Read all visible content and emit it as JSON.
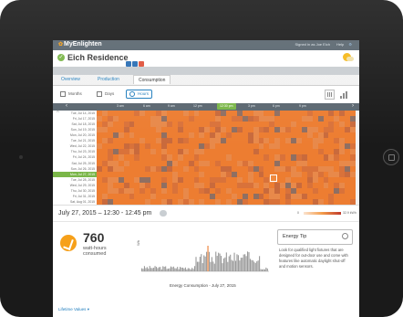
{
  "header": {
    "logo": "MyEnlighten",
    "signed_in": "Signed in as Joe Eich",
    "help": "Help"
  },
  "site": {
    "name": "Eich Residence"
  },
  "tabs": [
    {
      "label": "Overview"
    },
    {
      "label": "Production"
    },
    {
      "label": "Consumption"
    }
  ],
  "toolbar": {
    "months": "Months",
    "days": "Days",
    "hours": "Hours"
  },
  "hours": [
    "3 am",
    "6 am",
    "9 am",
    "12 pm",
    "12:30 pm",
    "3 pm",
    "6 pm",
    "9 pm"
  ],
  "dates": [
    "Tue, Jul 14, 2015",
    "Fri, Jul 17, 2015",
    "Sat, Jul 18, 2015",
    "Sun, Jul 19, 2015",
    "Mon, Jul 20, 2015",
    "Tue, Jul 21, 2015",
    "Wed, Jul 22, 2015",
    "Thu, Jul 23, 2015",
    "Fri, Jul 24, 2015",
    "Sat, Jul 25, 2015",
    "Sun, Jul 26, 2015",
    "Mon, Jul 27, 2015",
    "Tue, Jul 28, 2015",
    "Wed, Jul 29, 2015",
    "Thu, Jul 30, 2015",
    "Fri, Jul 31, 2015",
    "Sat, Aug 01, 2015"
  ],
  "selected_date_index": 11,
  "detail": {
    "title": "July 27, 2015 – 12:30 - 12:45 pm",
    "legend_min": "0",
    "legend_max": "32.9 kWh",
    "value": "760",
    "unit": "watt-hours consumed",
    "chart_ylabel": "Wh",
    "chart_caption": "Energy Consumption - July 27, 2015",
    "tip_title": "Energy Tip",
    "tip_text": "Look for qualified light fixtures that are designed for out-door use and come with features like automatic daylight shut-off and motion sensors.",
    "lifetime": "Lifetime Values"
  },
  "colors": {
    "accent_green": "#7ab648",
    "heat_orange": "#ed7d31",
    "brand_orange": "#f6a01a",
    "link_blue": "#1f7dbd"
  }
}
